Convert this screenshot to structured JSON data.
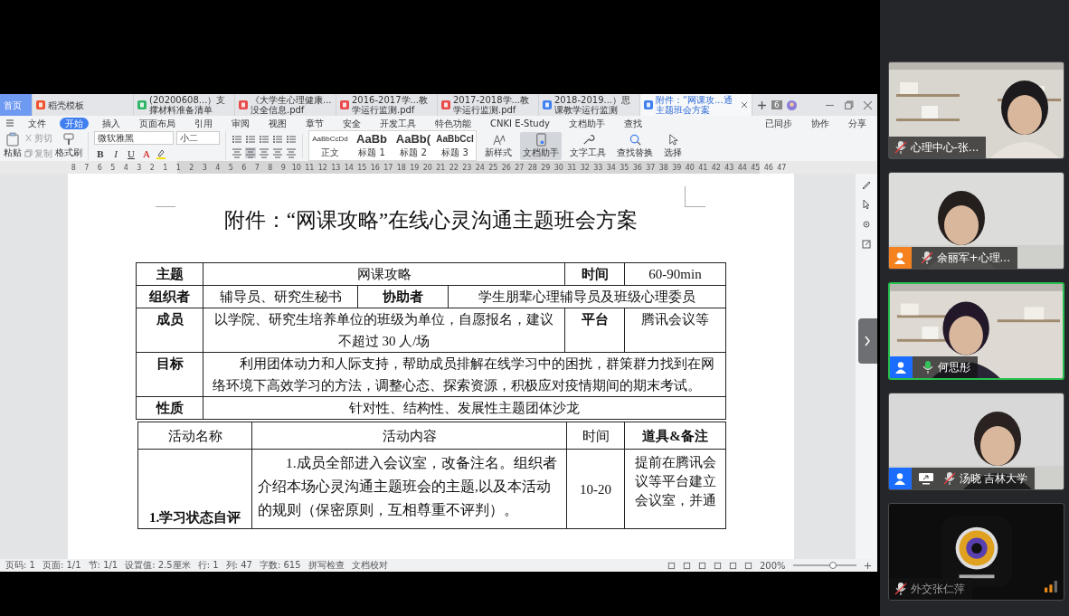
{
  "document_window": {
    "tabs": [
      {
        "label": "首页",
        "kind": "home",
        "selected": false
      },
      {
        "label": "稻壳模板",
        "kind": "docer",
        "selected": false
      },
      {
        "label": "(20200608...）支撑材料准备清单",
        "kind": "sheet",
        "selected": false
      },
      {
        "label": "《大学生心理健康...没全信息.pdf",
        "kind": "pdf",
        "selected": false
      },
      {
        "label": "2016-2017学...教学运行监测.pdf",
        "kind": "pdf",
        "selected": false
      },
      {
        "label": "2017-2018学...教学运行监测.pdf",
        "kind": "pdf",
        "selected": false
      },
      {
        "label": "2018-2019...）思课教学运行监测",
        "kind": "word",
        "selected": false
      },
      {
        "label": "附件：“网课攻...通主题班会方案",
        "kind": "word",
        "selected": true
      }
    ],
    "window_count": "6",
    "menu": [
      {
        "label": "文件",
        "selected": false
      },
      {
        "label": "开始",
        "selected": true
      },
      {
        "label": "插入",
        "selected": false
      },
      {
        "label": "页面布局",
        "selected": false
      },
      {
        "label": "引用",
        "selected": false
      },
      {
        "label": "审阅",
        "selected": false
      },
      {
        "label": "视图",
        "selected": false
      },
      {
        "label": "章节",
        "selected": false
      },
      {
        "label": "安全",
        "selected": false
      },
      {
        "label": "开发工具",
        "selected": false
      },
      {
        "label": "特色功能",
        "selected": false
      },
      {
        "label": "CNKI E-Study",
        "selected": false
      },
      {
        "label": "文档助手",
        "selected": false
      },
      {
        "label": "查找",
        "selected": false
      }
    ],
    "menu_right": [
      "已同步",
      "协作",
      "分享"
    ],
    "toolbar": {
      "paste": "粘贴",
      "cut": "剪切",
      "copy": "复制",
      "format_painter": "格式刷",
      "font": "微软雅黑",
      "size": "小二",
      "format_buttons": [
        "B",
        "I",
        "U",
        "A"
      ],
      "styles": [
        {
          "preview": "AaBbCcDd",
          "label": "正文"
        },
        {
          "preview": "AaBb",
          "label": "标题 1"
        },
        {
          "preview": "AaBb(",
          "label": "标题 2"
        },
        {
          "preview": "AaBbCcI",
          "label": "标题 3"
        }
      ],
      "tools": [
        {
          "label": "新样式",
          "kind": "style",
          "selected": false
        },
        {
          "label": "文档助手",
          "kind": "assistant",
          "selected": true
        },
        {
          "label": "文字工具",
          "kind": "wrench",
          "selected": false
        },
        {
          "label": "查找替换",
          "kind": "search",
          "selected": false
        },
        {
          "label": "选择",
          "kind": "cursor",
          "selected": false
        }
      ]
    },
    "ruler": [
      "8",
      "7",
      "6",
      "5",
      "4",
      "3",
      "2",
      "1",
      "1",
      "2",
      "3",
      "4",
      "5",
      "6",
      "7",
      "8",
      "9",
      "10",
      "11",
      "12",
      "13",
      "14",
      "15",
      "16",
      "17",
      "18",
      "19",
      "20",
      "21",
      "22",
      "23",
      "24",
      "25",
      "26",
      "27",
      "28",
      "29",
      "30",
      "31",
      "32",
      "33",
      "34",
      "35",
      "36",
      "37",
      "38",
      "39",
      "40",
      "41",
      "42",
      "43",
      "44",
      "45",
      "46",
      "47"
    ],
    "document": {
      "title": "附件：“网课攻略”在线心灵沟通主题班会方案",
      "info_table": {
        "topic_label": "主题",
        "topic": "网课攻略",
        "time_label": "时间",
        "time": "60-90min",
        "organizer_label": "组织者",
        "organizer": "辅导员、研究生秘书",
        "assistant_label": "协助者",
        "assistant": "学生朋辈心理辅导员及班级心理委员",
        "members_label": "成员",
        "members": "以学院、研究生培养单位的班级为单位，自愿报名，建议不超过 30 人/场",
        "platform_label": "平台",
        "platform": "腾讯会议等",
        "goal_label": "目标",
        "goal": "利用团体动力和人际支持，帮助成员排解在线学习中的困扰，群策群力找到在网络环境下高效学习的方法，调整心态、探索资源，积极应对疫情期间的期末考试。",
        "nature_label": "性质",
        "nature": "针对性、结构性、发展性主题团体沙龙"
      },
      "activity_table": {
        "columns": [
          "活动名称",
          "活动内容",
          "时间",
          "道具&备注"
        ],
        "rows": [
          {
            "name": "1.学习状态自评",
            "content": "1.成员全部进入会议室，改备注名。组织者介绍本场心灵沟通主题班会的主题,以及本活动的规则（保密原则，互相尊重不评判）。",
            "time": "10-20",
            "notes": "提前在腾讯会议等平台建立会议室，并通"
          }
        ]
      }
    },
    "status_bar": [
      "页码: 1",
      "页面: 1/1",
      "节: 1/1",
      "设置值: 2.5厘米",
      "行: 1",
      "列: 47",
      "字数: 615",
      "拼写检查",
      "文档校对"
    ],
    "zoom": "200%",
    "zoom_slider": {
      "level": 0.63
    }
  },
  "participants": [
    {
      "name": "心理中心-张...",
      "muted": true,
      "speaking": false,
      "sharing": false,
      "kind": "picture"
    },
    {
      "name": "余丽军+心理...",
      "muted": true,
      "speaking": false,
      "sharing": false,
      "color": "#f5821f",
      "kind": "picture"
    },
    {
      "name": "何思彤",
      "muted": false,
      "speaking": true,
      "sharing": false,
      "color": "#1a6dff",
      "kind": "picture"
    },
    {
      "name": "汤晓 吉林大学",
      "muted": true,
      "speaking": false,
      "sharing": true,
      "color": "#1a6dff",
      "kind": "picture"
    },
    {
      "name": "外交张仁萍",
      "muted": true,
      "speaking": false,
      "sharing": false,
      "kind": "camera_off"
    }
  ]
}
